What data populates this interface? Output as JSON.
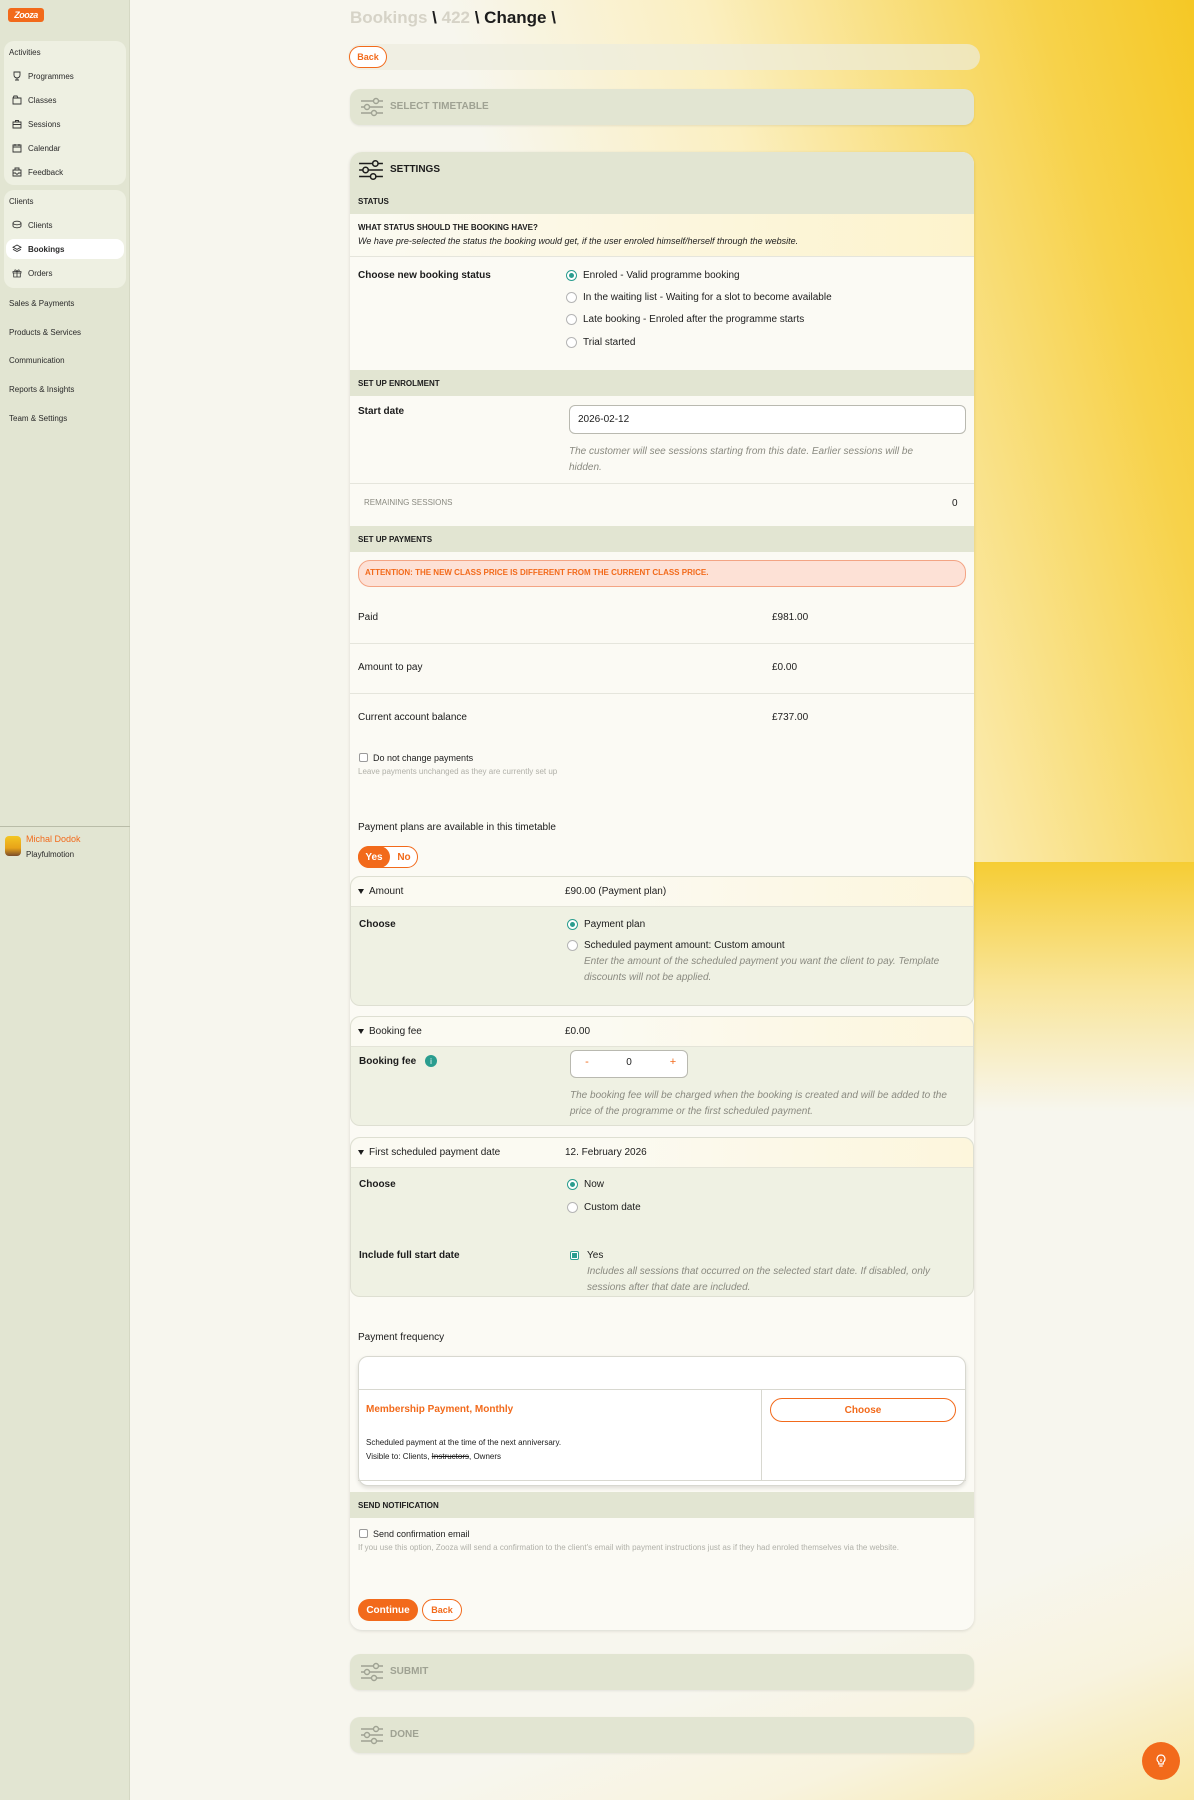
{
  "app": {
    "logo_text": "Zooza"
  },
  "sidebar": {
    "activities": {
      "title": "Activities",
      "items": [
        {
          "label": "Programmes",
          "icon": "trophy-icon"
        },
        {
          "label": "Classes",
          "icon": "folder-icon"
        },
        {
          "label": "Sessions",
          "icon": "briefcase-icon"
        },
        {
          "label": "Calendar",
          "icon": "calendar-icon"
        },
        {
          "label": "Feedback",
          "icon": "inbox-icon"
        }
      ]
    },
    "clients": {
      "title": "Clients",
      "items": [
        {
          "label": "Clients",
          "icon": "coins-icon"
        },
        {
          "label": "Bookings",
          "icon": "layers-icon",
          "active": true
        },
        {
          "label": "Orders",
          "icon": "gift-icon"
        }
      ]
    },
    "links": [
      "Sales & Payments",
      "Products & Services",
      "Communication",
      "Reports & Insights",
      "Team & Settings"
    ],
    "user": {
      "name": "Michal Dodok",
      "org": "Playfulmotion"
    }
  },
  "header": {
    "crumbs": {
      "part1": "Bookings",
      "sep1": " \\ ",
      "part2": "422",
      "sep2": " \\ ",
      "part3": "Change",
      "sep3": " \\"
    },
    "back_label": "Back"
  },
  "steps": {
    "select_timetable": "SELECT TIMETABLE",
    "settings": "SETTINGS",
    "submit": "SUBMIT",
    "done": "DONE"
  },
  "status": {
    "section": "STATUS",
    "question": "WHAT STATUS SHOULD THE BOOKING HAVE?",
    "note": "We have pre-selected the status the booking would get, if the user enroled himself/herself through the website.",
    "label": "Choose new booking status",
    "options": [
      {
        "label": "Enroled - Valid programme booking",
        "selected": true
      },
      {
        "label": "In the waiting list - Waiting for a slot to become available",
        "selected": false
      },
      {
        "label": "Late booking - Enroled after the programme starts",
        "selected": false
      },
      {
        "label": "Trial started",
        "selected": false
      }
    ]
  },
  "enrolment": {
    "section": "SET UP ENROLMENT",
    "start_date_label": "Start date",
    "start_date_value": "2026-02-12",
    "start_date_hint": "The customer will see sessions starting from this date. Earlier sessions will be hidden.",
    "remaining_label": "REMAINING SESSIONS",
    "remaining_value": "0"
  },
  "payments": {
    "section": "SET UP PAYMENTS",
    "attention": "ATTENTION: THE NEW CLASS PRICE IS DIFFERENT FROM THE CURRENT CLASS PRICE.",
    "rows": [
      {
        "label": "Paid",
        "value": "£981.00"
      },
      {
        "label": "Amount to pay",
        "value": "£0.00"
      },
      {
        "label": "Current account balance",
        "value": "£737.00"
      }
    ],
    "no_change_label": "Do not change payments",
    "no_change_hint": "Leave payments unchanged as they are currently set up",
    "plans_available": "Payment plans are available in this timetable",
    "yes": "Yes",
    "no": "No",
    "amount": {
      "title": "Amount",
      "value": "£90.00 (Payment plan)",
      "choose": "Choose",
      "opt1": "Payment plan",
      "opt2": "Scheduled payment amount: Custom amount",
      "opt2_hint": "Enter the amount of the scheduled payment you want the client to pay. Template discounts will not be applied."
    },
    "booking_fee": {
      "title": "Booking fee",
      "value": "£0.00",
      "label": "Booking fee",
      "minus": "-",
      "input": "0",
      "plus": "+",
      "hint": "The booking fee will be charged when the booking is created and will be added to the price of the programme or the first scheduled payment."
    },
    "first_payment": {
      "title": "First scheduled payment date",
      "value": "12. February 2026",
      "choose": "Choose",
      "opt1": "Now",
      "opt2": "Custom date",
      "include_label": "Include full start date",
      "include_yes": "Yes",
      "include_hint": "Includes all sessions that occurred on the selected start date. If disabled, only sessions after that date are included."
    },
    "frequency": {
      "label": "Payment frequency",
      "plan_title": "Membership Payment, Monthly",
      "choose_button": "Choose",
      "desc": "Scheduled payment at the time of the next anniversary.",
      "visible_prefix": "Visible to: Clients, ",
      "visible_struck": "Instructors",
      "visible_suffix": ", Owners"
    }
  },
  "notification": {
    "section": "SEND NOTIFICATION",
    "checkbox_label": "Send confirmation email",
    "hint": "If you use this option, Zooza will send a confirmation to the client's email with payment instructions just as if they had enroled themselves via the website."
  },
  "actions": {
    "continue": "Continue",
    "back": "Back"
  },
  "colors": {
    "accent": "#f26a1b",
    "radio": "#2a9d8f",
    "panel": "#e2e5d2"
  },
  "help_button": {
    "icon": "bulb-icon"
  }
}
